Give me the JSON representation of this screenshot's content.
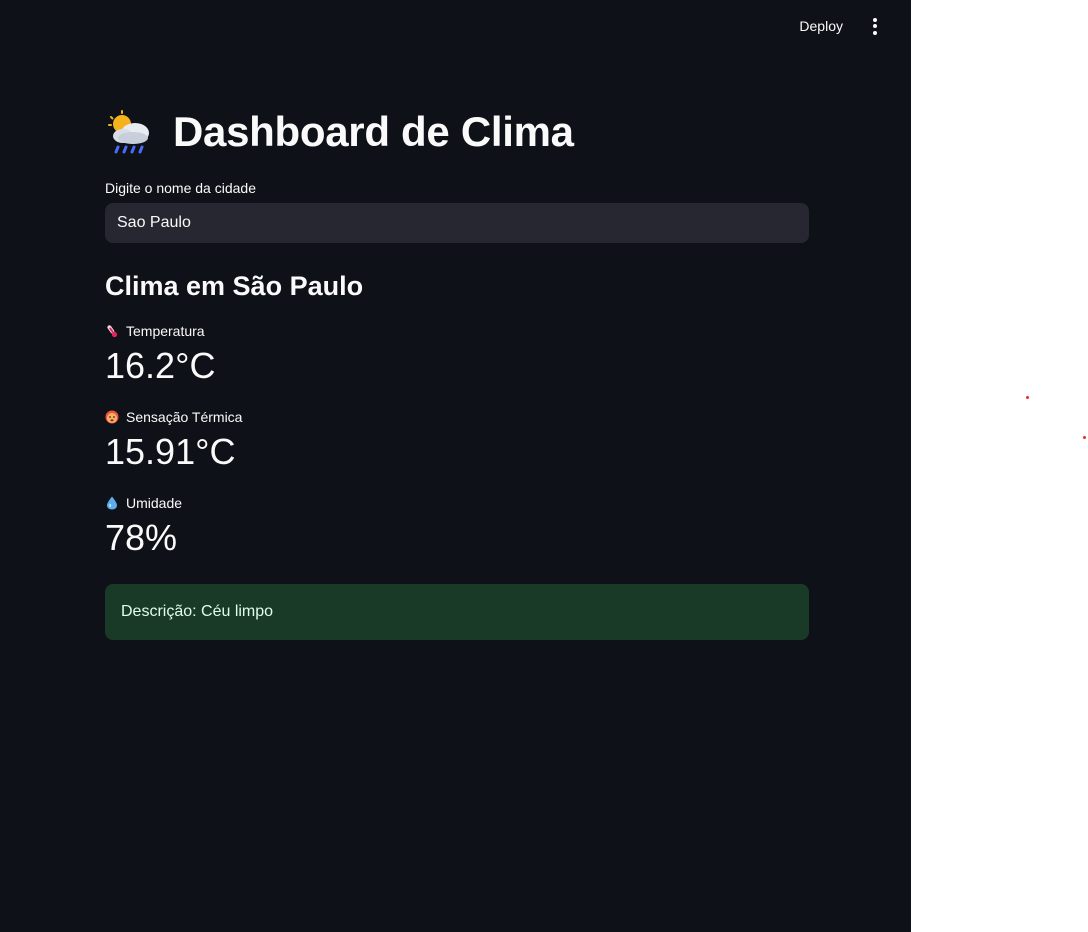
{
  "header": {
    "deploy_label": "Deploy",
    "menu_icon": "vertical-dots-icon"
  },
  "page": {
    "title_icon": "cloud-sun-rain-icon",
    "title": "Dashboard de Clima"
  },
  "city_input": {
    "label": "Digite o nome da cidade",
    "value": "Sao Paulo"
  },
  "weather": {
    "heading": "Clima em São Paulo",
    "metrics": [
      {
        "icon": "thermometer-icon",
        "label": "Temperatura",
        "value": "16.2°C"
      },
      {
        "icon": "hot-face-icon",
        "label": "Sensação Térmica",
        "value": "15.91°C"
      },
      {
        "icon": "droplet-icon",
        "label": "Umidade",
        "value": "78%"
      }
    ],
    "description": "Descrição: Céu limpo"
  },
  "colors": {
    "background": "#0e1117",
    "input_bg": "#262730",
    "success_bg": "#1a3a28",
    "success_text": "#dffde9"
  }
}
